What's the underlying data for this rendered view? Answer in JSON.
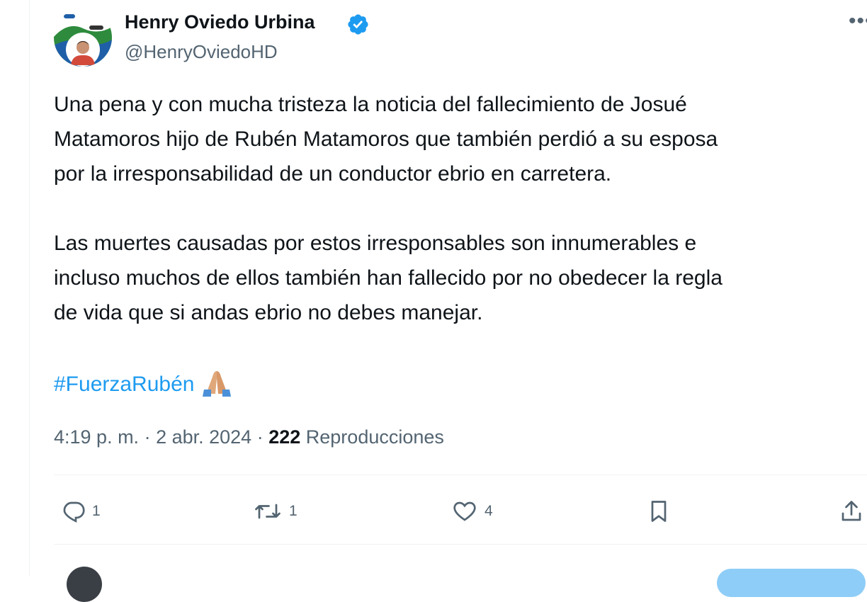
{
  "author": {
    "display_name": "Henry Oviedo Urbina",
    "handle": "@HenryOviedoHD",
    "verified": true
  },
  "tweet": {
    "paragraphs": [
      [
        "Una pena y con mucha tristeza la noticia del fallecimiento de Josué",
        "Matamoros hijo de Rubén Matamoros que también perdió a su esposa",
        "por la irresponsabilidad de un conductor ebrio en carretera."
      ],
      [
        "Las muertes causadas por estos irresponsables son innumerables e",
        "incluso muchos de ellos también han fallecido por no obedecer la regla",
        "de vida que si andas ebrio no debes manejar."
      ]
    ],
    "hashtag": "#FuerzaRubén",
    "emoji": "folded-hands"
  },
  "meta": {
    "time": "4:19 p. m.",
    "separator": " · ",
    "date": "2 abr. 2024",
    "views_count": "222",
    "views_label": "Reproducciones"
  },
  "actions": {
    "replies": "1",
    "reposts": "1",
    "likes": "4"
  },
  "colors": {
    "accent": "#1d9bf0",
    "secondary_text": "#536471",
    "primary_text": "#0f1419",
    "divider": "#eff3f4"
  },
  "icons": [
    "verified-badge-icon",
    "more-icon",
    "reply-icon",
    "repost-icon",
    "like-icon",
    "bookmark-icon",
    "share-icon",
    "folded-hands-emoji"
  ]
}
